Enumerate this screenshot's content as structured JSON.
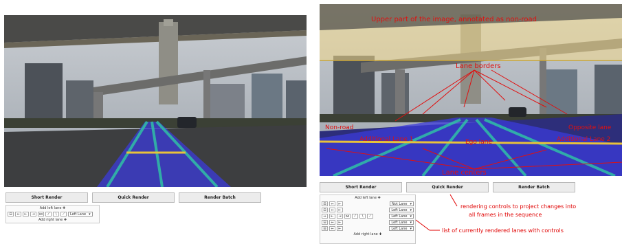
{
  "left": {
    "buttons": [
      "Short Render",
      "Quick Render",
      "Render Batch"
    ],
    "add_left_lane": "Add left lane",
    "add_right_lane": "Add right lane",
    "lane_select": "Left Lane"
  },
  "right": {
    "buttons": [
      "Short Render",
      "Quick Render",
      "Render Batch"
    ],
    "add_left_lane": "Add left lane",
    "add_right_lane": "Add right lane",
    "lanes": [
      {
        "select": "Not Lane"
      },
      {
        "select": "Left Lane"
      },
      {
        "select": "Left Lane"
      },
      {
        "select": "Left Lane"
      },
      {
        "select": "Left Lane"
      }
    ]
  },
  "annotations": {
    "upper": "Upper part of the image, annotated as non-road",
    "lane_borders": "Lane borders",
    "non_road": "Non-road",
    "additional_lane_1": "Additional Lane 1",
    "ego_lane": "Ego lane",
    "additional_lane_2": "Additional Lane 2",
    "opposite_lane": "Opposite lane",
    "lane_centers": "Lane centers",
    "rendering_note_1": "rendering controls to project changes into",
    "rendering_note_2": "all frames in the sequence",
    "lanes_note": "list of currently rendered lanes with controls"
  },
  "colors": {
    "annotation_red": "#e00000",
    "lane_fill": "#3b3bd9",
    "lane_center": "#2fc9a5",
    "lane_border": "#e8c23a",
    "non_road_tint": "#f3d98a"
  }
}
